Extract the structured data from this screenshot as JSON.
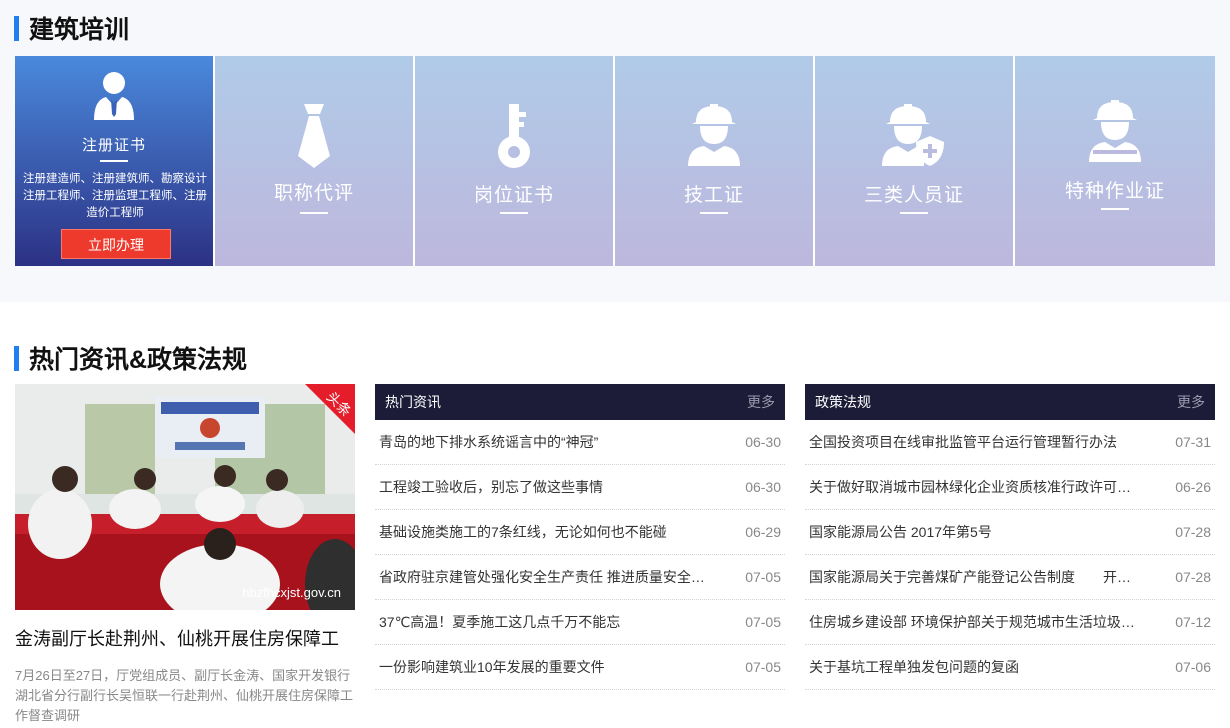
{
  "training": {
    "title": "建筑培训",
    "cards": [
      {
        "label": "注册证书",
        "icon": "user-suit-icon",
        "desc": "注册建造师、注册建筑师、勘察设计注册工程师、注册监理工程师、注册造价工程师",
        "button": "立即办理"
      },
      {
        "label": "职称代评",
        "icon": "necktie-icon"
      },
      {
        "label": "岗位证书",
        "icon": "key-icon"
      },
      {
        "label": "技工证",
        "icon": "hardhat-worker-icon"
      },
      {
        "label": "三类人员证",
        "icon": "worker-shield-icon"
      },
      {
        "label": "特种作业证",
        "icon": "special-worker-icon"
      }
    ]
  },
  "news": {
    "title": "热门资讯&政策法规",
    "featured": {
      "badge": "头条",
      "watermark": "hbzfhcxjst.gov.cn",
      "headline": "金涛副厅长赴荆州、仙桃开展住房保障工",
      "summary": "7月26日至27日，厅党组成员、副厅长金涛、国家开发银行湖北省分行副行长吴恒联一行赴荆州、仙桃开展住房保障工作督查调研"
    },
    "hot": {
      "title": "热门资讯",
      "more": "更多",
      "items": [
        {
          "t": "青岛的地下排水系统谣言中的“神冠”",
          "d": "06-30"
        },
        {
          "t": "工程竣工验收后，别忘了做这些事情",
          "d": "06-30"
        },
        {
          "t": "基础设施类施工的7条红线，无论如何也不能碰",
          "d": "06-29"
        },
        {
          "t": "省政府驻京建管处强化安全生产责任 推进质量安全提升行动",
          "d": "07-05"
        },
        {
          "t": "37℃高温！夏季施工这几点千万不能忘",
          "d": "07-05"
        },
        {
          "t": "一份影响建筑业10年发展的重要文件",
          "d": "07-05"
        }
      ]
    },
    "policy": {
      "title": "政策法规",
      "more": "更多",
      "items": [
        {
          "t": "全国投资项目在线审批监管平台运行管理暂行办法",
          "d": "07-31"
        },
        {
          "t": "关于做好取消城市园林绿化企业资质核准行政许可事项有关工作的通知",
          "d": "06-26"
        },
        {
          "t": "国家能源局公告 2017年第5号",
          "d": "07-28"
        },
        {
          "t": "国家能源局关于完善煤矿产能登记公告制度　　开展建设生产煤矿产能核实工作的通知",
          "d": "07-28"
        },
        {
          "t": "住房城乡建设部 环境保护部关于规范城市生活垃圾跨界清运处理的通知",
          "d": "07-12"
        },
        {
          "t": "关于基坑工程单独发包问题的复函",
          "d": "07-06"
        }
      ]
    }
  }
}
